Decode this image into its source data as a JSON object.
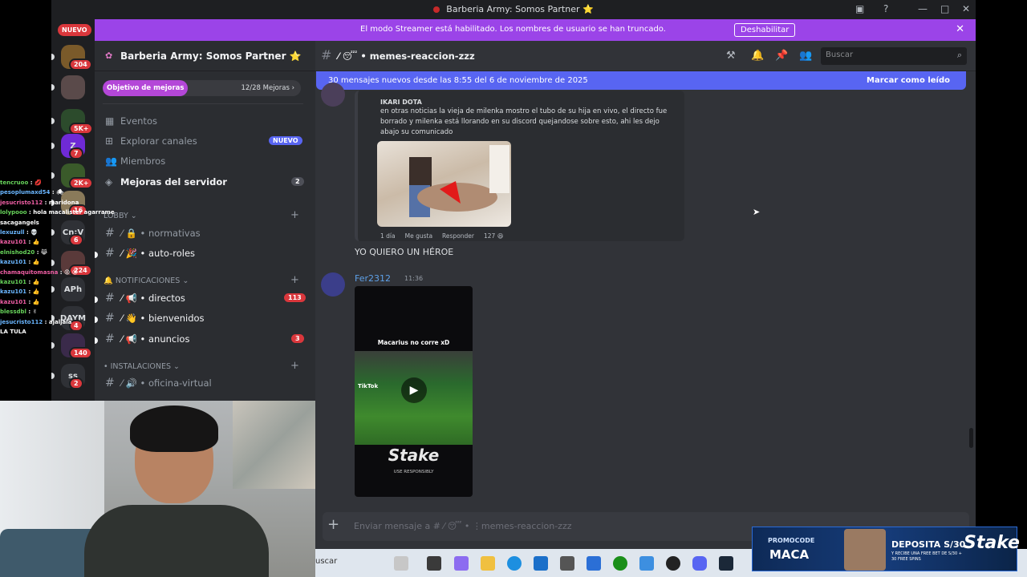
{
  "window": {
    "title": "Barberia Army: Somos Partner ⭐"
  },
  "banner": {
    "message": "El modo Streamer está habilitado. Los nombres de usuario se han truncado.",
    "button_label": "Deshabilitar"
  },
  "rail": {
    "nuevo_label": "NUEVO",
    "servers": [
      {
        "label": "",
        "badge": "204"
      },
      {
        "label": "",
        "badge": ""
      },
      {
        "label": "",
        "badge": "5K+"
      },
      {
        "label": "Z",
        "badge": "7"
      },
      {
        "label": "",
        "badge": "2K+"
      },
      {
        "label": "",
        "badge": "16"
      },
      {
        "label": "Cn:V",
        "badge": "6"
      },
      {
        "label": "",
        "badge": "224"
      },
      {
        "label": "APh",
        "badge": ""
      },
      {
        "label": "DAYM",
        "badge": "4"
      },
      {
        "label": "",
        "badge": "140"
      },
      {
        "label": "ss",
        "badge": "2"
      }
    ]
  },
  "chat_overlay": [
    {
      "user": "tencruoo",
      "msg": ": 💋"
    },
    {
      "user": "pesoplumaxd54",
      "msg": ": 🕷"
    },
    {
      "user": "jesucristo112",
      "msg": ": maridona"
    },
    {
      "user": "lolypooo",
      "msg": ": hola macalister agarrame sacagangels"
    },
    {
      "user": "lexuzull",
      "msg": ": 💀"
    },
    {
      "user": "kazu101",
      "msg": ": 👍"
    },
    {
      "user": "elnishod20",
      "msg": ": 😹"
    },
    {
      "user": "kazu101",
      "msg": ": 👍"
    },
    {
      "user": "chamaquitomasna",
      "msg": ": 😡 😡"
    },
    {
      "user": "kazu101",
      "msg": ": 👍"
    },
    {
      "user": "kazu101",
      "msg": ": 👍"
    },
    {
      "user": "kazu101",
      "msg": ": 👍"
    },
    {
      "user": "blessdbl",
      "msg": ": ✌"
    },
    {
      "user": "jesucristo112",
      "msg": ": ajaljala"
    },
    {
      "user": "",
      "msg": "LA TULA"
    }
  ],
  "sidebar": {
    "server_name": "Barberia Army: Somos Partner ⭐",
    "goal": {
      "label": "Objetivo de mejoras",
      "count": "12/28 Mejoras ›",
      "progress": 0.43
    },
    "nav": [
      {
        "icon": "calendar-icon",
        "label": "Eventos",
        "badge": ""
      },
      {
        "icon": "browse-channels-icon",
        "label": "Explorar canales",
        "badge": "NUEVO"
      },
      {
        "icon": "members-icon",
        "label": "Miembros",
        "badge": ""
      },
      {
        "icon": "boost-icon",
        "label": "Mejoras del servidor",
        "badge": "2"
      }
    ],
    "categories": [
      {
        "label": "LOBBY ⌄",
        "channels": [
          {
            "name": "normativas",
            "emoji": "⁄ 🔒 • ",
            "badge": "",
            "unread": false
          },
          {
            "name": "auto-roles",
            "emoji": "⁄ 🎉 • ",
            "badge": "",
            "unread": true
          }
        ]
      },
      {
        "label": "🔔 NOTIFICACIONES ⌄",
        "channels": [
          {
            "name": "directos",
            "emoji": "⁄ 📢 • ",
            "badge": "113",
            "unread": true
          },
          {
            "name": "bienvenidos",
            "emoji": "⁄ 👋 • ",
            "badge": "",
            "unread": true
          },
          {
            "name": "anuncios",
            "emoji": "⁄ 📢 • ",
            "badge": "3",
            "unread": true
          }
        ]
      },
      {
        "label": "• INSTALACIONES ⌄",
        "channels": [
          {
            "name": "oficina-virtual",
            "emoji": "⁄ 🔊 • ",
            "badge": "",
            "unread": false
          }
        ]
      }
    ]
  },
  "main": {
    "channel": {
      "emoji": "⁄ 😴 • ",
      "name": "memes-reaccion-zzz"
    },
    "search_placeholder": "Buscar",
    "new_messages": {
      "text": "30 mensajes nuevos desde las 8:55 del 6 de noviembre de 2025",
      "mark_read": "Marcar como leído"
    },
    "quoted": {
      "author": "IKARI DOTA",
      "text": "en otras noticias la vieja de milenka mostro el tubo de su hija en vivo, el directo fue borrado y milenka está llorando en su discord quejandose sobre esto, ahi les dejo abajo su comunicado",
      "meta": [
        "1 día",
        "Me gusta",
        "Responder",
        "127 😆"
      ]
    },
    "plain_message": "YO QUIERO UN HÉROE",
    "message2": {
      "user": "Fer2312",
      "time": "11:36",
      "video_caption": "Macarius no corre xD",
      "video_tag": "TikTok",
      "video_brand": "Stake",
      "video_sub": "USE RESPONSIBLY"
    },
    "composer_placeholder": "Enviar mensaje a # ⁄ 😴 • ⋮memes-reaccion-zzz"
  },
  "taskbar": {
    "search_label": "uscar",
    "promo": {
      "code_label": "PROMOCODE",
      "code": "MACA",
      "deposit": "DEPOSITA S/30",
      "sub": "Y RECIBE UNA FREE BET DE S/30 + 30 FREE SPINS",
      "brand": "Stake"
    }
  },
  "colors": {
    "banner": "#9b44e8",
    "accent": "#5865f2",
    "badge_red": "#da373c",
    "sidebar": "#2b2d31",
    "main": "#313338"
  }
}
